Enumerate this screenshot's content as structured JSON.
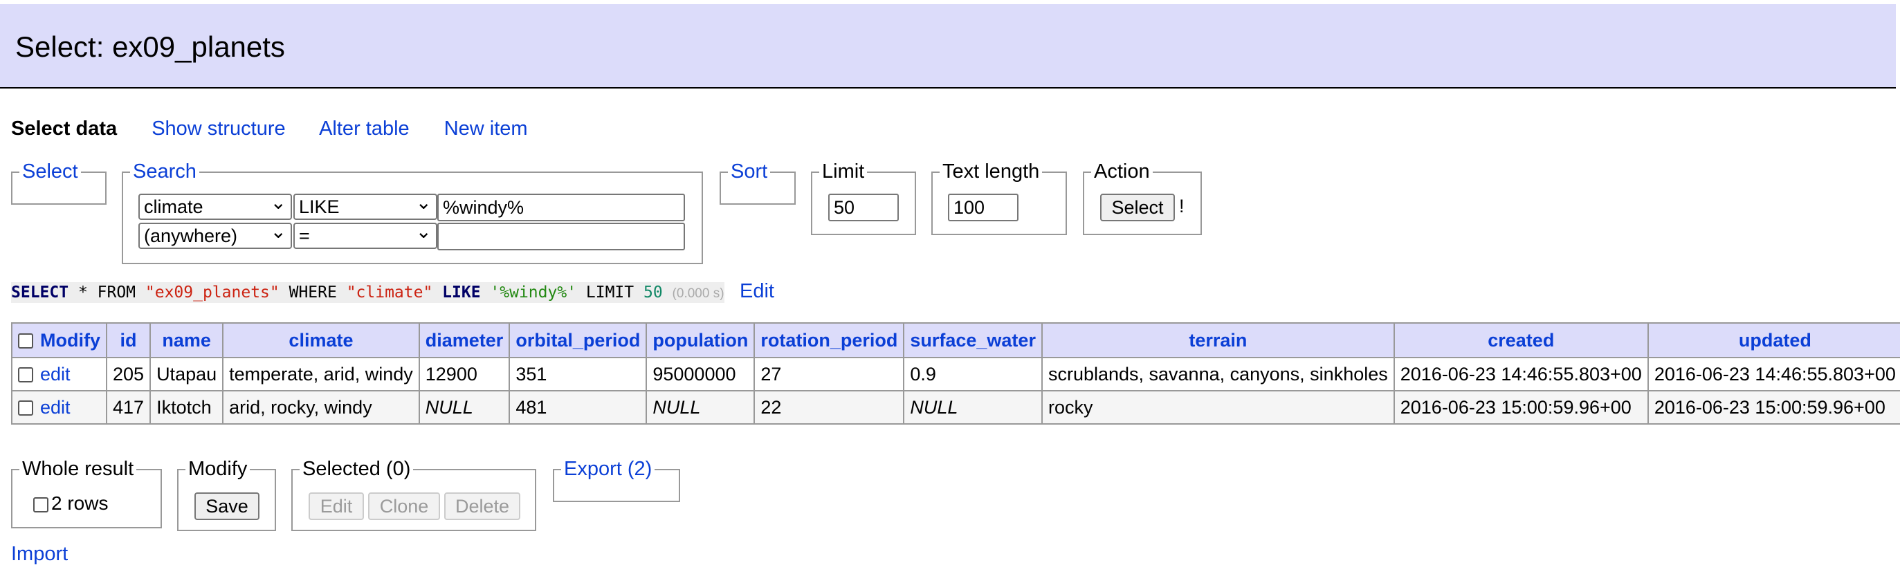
{
  "page": {
    "title": "Select: ex09_planets"
  },
  "nav": {
    "current": "Select data",
    "links": [
      "Show structure",
      "Alter table",
      "New item"
    ]
  },
  "fieldsets": {
    "select": "Select",
    "search": "Search",
    "sort": "Sort",
    "limit": "Limit",
    "text_length": "Text length",
    "action": "Action"
  },
  "search": {
    "row1": {
      "column": "climate",
      "operator": "LIKE",
      "value": "%windy%"
    },
    "row2": {
      "column": "(anywhere)",
      "operator": "=",
      "value": ""
    }
  },
  "limit_value": "50",
  "text_length_value": "100",
  "action": {
    "button": "Select",
    "suffix": "!"
  },
  "query": {
    "p1": "SELECT",
    "p2": " * FROM ",
    "p3": "\"ex09_planets\"",
    "p4": " WHERE ",
    "p5": "\"climate\"",
    "p6": " LIKE",
    "p7": " ",
    "p8": "'%windy%'",
    "p9": " LIMIT ",
    "p10": "50",
    "time": "(0.000 s)",
    "edit_link": "Edit"
  },
  "table": {
    "modify_header": "Modify",
    "columns": [
      "id",
      "name",
      "climate",
      "diameter",
      "orbital_period",
      "population",
      "rotation_period",
      "surface_water",
      "terrain",
      "created",
      "updated"
    ],
    "rows": [
      {
        "edit": "edit",
        "id": "205",
        "name": "Utapau",
        "climate": "temperate, arid, windy",
        "diameter": "12900",
        "orbital_period": "351",
        "population": "95000000",
        "rotation_period": "27",
        "surface_water": "0.9",
        "terrain": "scrublands, savanna, canyons, sinkholes",
        "created": "2016-06-23 14:46:55.803+00",
        "updated": "2016-06-23 14:46:55.803+00"
      },
      {
        "edit": "edit",
        "id": "417",
        "name": "Iktotch",
        "climate": "arid, rocky, windy",
        "diameter": "NULL",
        "orbital_period": "481",
        "population": "NULL",
        "rotation_period": "22",
        "surface_water": "NULL",
        "terrain": "rocky",
        "created": "2016-06-23 15:00:59.96+00",
        "updated": "2016-06-23 15:00:59.96+00"
      }
    ]
  },
  "bottom": {
    "whole_result": {
      "legend": "Whole result",
      "label": "2 rows"
    },
    "modify": {
      "legend": "Modify",
      "save": "Save"
    },
    "selected": {
      "legend": "Selected (0)",
      "edit": "Edit",
      "clone": "Clone",
      "delete": "Delete"
    },
    "export": {
      "legend": "Export (2)"
    }
  },
  "import_link": "Import"
}
